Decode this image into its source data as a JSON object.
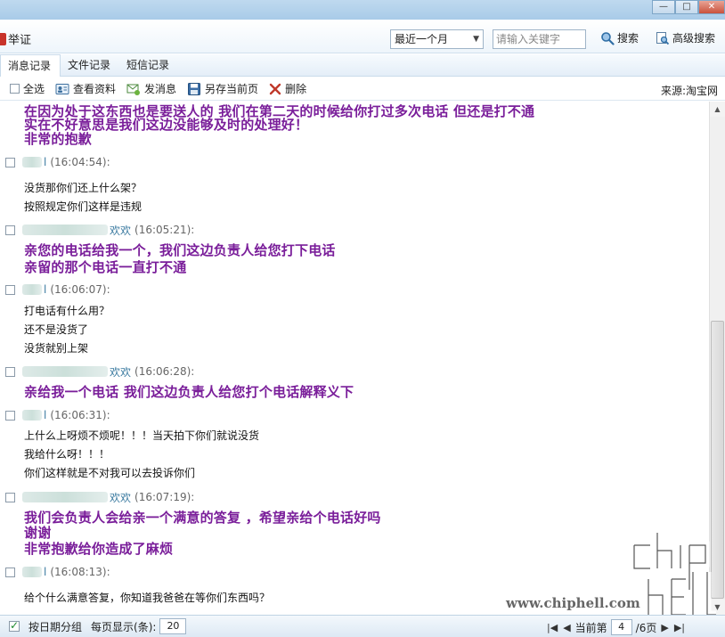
{
  "window": {
    "minimize": "—",
    "maximize": "□",
    "close": "✕"
  },
  "header": {
    "report_label": "举证",
    "range_select": "最近一个月",
    "search_placeholder": "请输入关键字",
    "search_button": "搜索",
    "advanced_search": "高级搜索"
  },
  "tabs": [
    {
      "label": "消息记录",
      "active": true
    },
    {
      "label": "文件记录",
      "active": false
    },
    {
      "label": "短信记录",
      "active": false
    }
  ],
  "toolbar": {
    "select_all": "全选",
    "view_profile": "查看资料",
    "send_message": "发消息",
    "save_page": "另存当前页",
    "delete": "删除",
    "source": "来源:淘宝网"
  },
  "messages": [
    {
      "type": "lines",
      "lines": [
        "在因为处于这东西也是要送人的  我们在第二天的时候给你打过多次电话    但还是打不通",
        "实在不好意思是我们这边没能够及时的处理好！",
        "非常的抱歉"
      ],
      "style": "big"
    },
    {
      "type": "head",
      "sender_suffix": "l",
      "time": "(16:04:54):"
    },
    {
      "type": "lines",
      "lines": [
        "没货那你们还上什么架？",
        "按照规定你们这样是违规"
      ],
      "style": "normal"
    },
    {
      "type": "head",
      "sender_suffix": "欢欢",
      "time": "(16:05:21):"
    },
    {
      "type": "lines",
      "lines": [
        "亲您的电话给我一个，我们这边负责人给您打下电话",
        "亲留的那个电话一直打不通"
      ],
      "style": "big"
    },
    {
      "type": "head",
      "sender_suffix": "l",
      "time": "(16:06:07):"
    },
    {
      "type": "lines",
      "lines": [
        "打电话有什么用？",
        "还不是没货了",
        "没货就别上架"
      ],
      "style": "normal"
    },
    {
      "type": "head",
      "sender_suffix": "欢欢",
      "time": "(16:06:28):"
    },
    {
      "type": "lines",
      "lines": [
        "亲给我一个电话  我们这边负责人给您打个电话解释义下"
      ],
      "style": "big"
    },
    {
      "type": "head",
      "sender_suffix": "l",
      "time": "(16:06:31):"
    },
    {
      "type": "lines",
      "lines": [
        "上什么上呀烦不烦呢！！！当天拍下你们就说没货",
        "我给什么呀！！！",
        "你们这样就是不对我可以去投诉你们"
      ],
      "style": "normal"
    },
    {
      "type": "head",
      "sender_suffix": "欢欢",
      "time": "(16:07:19):"
    },
    {
      "type": "lines",
      "lines": [
        "我们会负责人会给亲一个满意的答复 ，希望亲给个电话好吗",
        "谢谢",
        "非常抱歉给你造成了麻烦"
      ],
      "style": "big"
    },
    {
      "type": "head",
      "sender_suffix": "l",
      "time": "(16:08:13):"
    },
    {
      "type": "lines",
      "lines": [
        "给个什么满意答复，你知道我爸爸在等你们东西吗？"
      ],
      "style": "normal"
    }
  ],
  "watermark": "www.chiphell.com",
  "footer": {
    "group_by_date": "按日期分组",
    "per_page_label": "每页显示(条):",
    "per_page_value": "20",
    "first": "|◀",
    "prev": "◀",
    "current_label": "当前第",
    "current_page": "4",
    "total_pages": "/6页",
    "next": "▶",
    "last": "▶|"
  },
  "colors": {
    "agent_text": "#7a1e9a",
    "sender_name": "#3a7aa0",
    "accent": "#a9cbe8"
  }
}
